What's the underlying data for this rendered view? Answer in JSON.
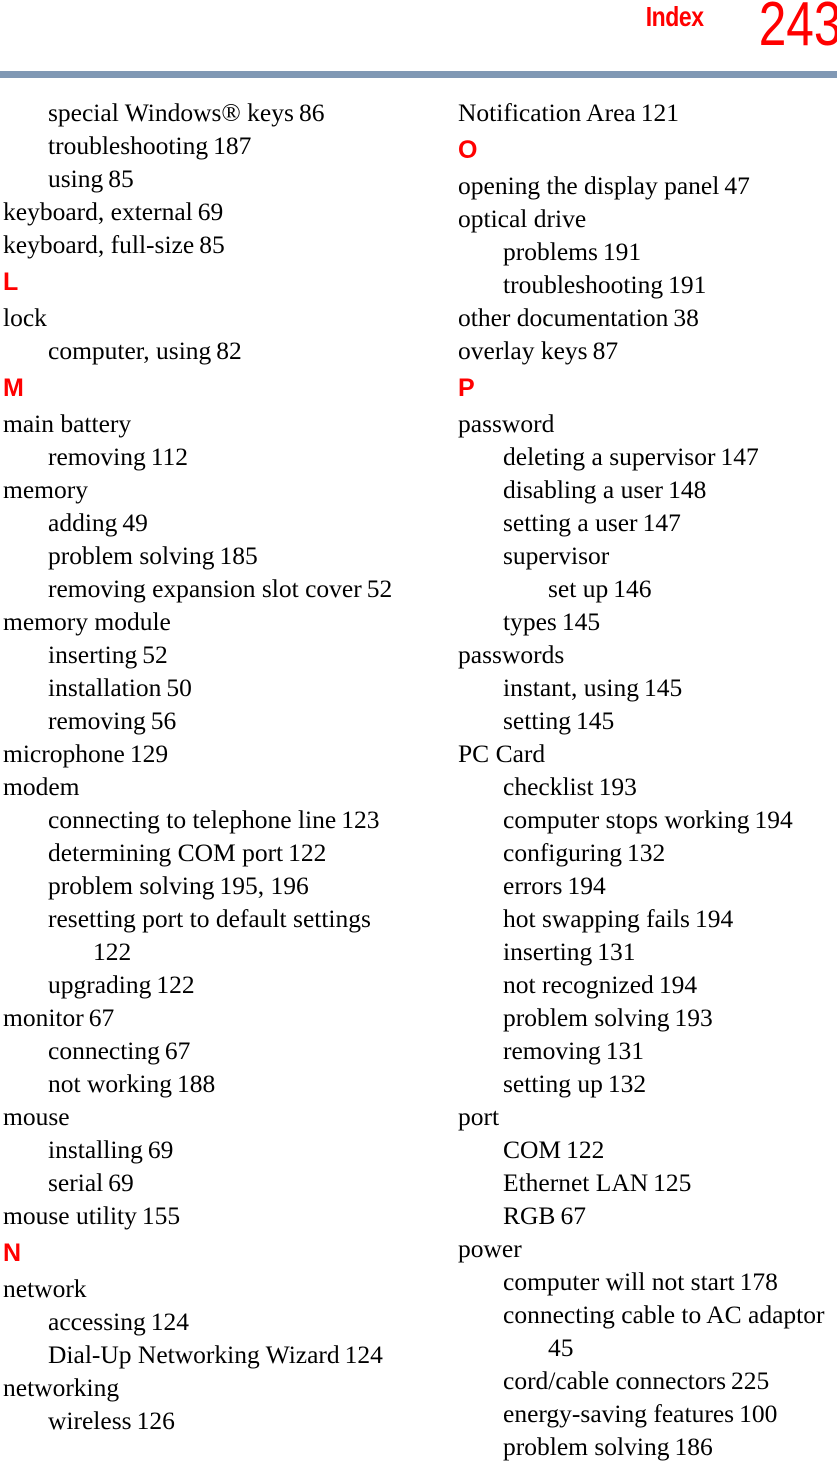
{
  "header": {
    "section_title": "Index",
    "page_number": "243",
    "accent_color": "#ff0000",
    "rule_color": "#8098b4"
  },
  "columns": [
    {
      "name": "left-column",
      "lines": [
        {
          "kind": "entry",
          "level": 1,
          "text": "special Windows® keys",
          "locator": "86"
        },
        {
          "kind": "entry",
          "level": 1,
          "text": "troubleshooting",
          "locator": "187"
        },
        {
          "kind": "entry",
          "level": 1,
          "text": "using",
          "locator": "85"
        },
        {
          "kind": "entry",
          "level": 0,
          "text": "keyboard, external",
          "locator": "69"
        },
        {
          "kind": "entry",
          "level": 0,
          "text": "keyboard, full-size",
          "locator": "85"
        },
        {
          "kind": "letter",
          "text": "L"
        },
        {
          "kind": "entry",
          "level": 0,
          "text": "lock",
          "locator": ""
        },
        {
          "kind": "entry",
          "level": 1,
          "text": "computer, using",
          "locator": "82"
        },
        {
          "kind": "letter",
          "text": "M"
        },
        {
          "kind": "entry",
          "level": 0,
          "text": "main battery",
          "locator": ""
        },
        {
          "kind": "entry",
          "level": 1,
          "text": "removing",
          "locator": "112"
        },
        {
          "kind": "entry",
          "level": 0,
          "text": "memory",
          "locator": ""
        },
        {
          "kind": "entry",
          "level": 1,
          "text": "adding",
          "locator": "49"
        },
        {
          "kind": "entry",
          "level": 1,
          "text": "problem solving",
          "locator": "185"
        },
        {
          "kind": "entry",
          "level": 1,
          "text": "removing expansion slot cover",
          "locator": "52"
        },
        {
          "kind": "entry",
          "level": 0,
          "text": "memory module",
          "locator": ""
        },
        {
          "kind": "entry",
          "level": 1,
          "text": "inserting",
          "locator": "52"
        },
        {
          "kind": "entry",
          "level": 1,
          "text": "installation",
          "locator": "50"
        },
        {
          "kind": "entry",
          "level": 1,
          "text": "removing",
          "locator": "56"
        },
        {
          "kind": "entry",
          "level": 0,
          "text": "microphone",
          "locator": "129"
        },
        {
          "kind": "entry",
          "level": 0,
          "text": "modem",
          "locator": ""
        },
        {
          "kind": "entry",
          "level": 1,
          "text": "connecting to telephone line",
          "locator": "123"
        },
        {
          "kind": "entry",
          "level": 1,
          "text": "determining COM port",
          "locator": "122"
        },
        {
          "kind": "entry",
          "level": 1,
          "text": "problem solving",
          "locator": "195, 196"
        },
        {
          "kind": "entry",
          "level": 1,
          "text": "resetting port to default settings",
          "locator": ""
        },
        {
          "kind": "entry",
          "level": 2,
          "text": "",
          "locator": "122"
        },
        {
          "kind": "entry",
          "level": 1,
          "text": "upgrading",
          "locator": "122"
        },
        {
          "kind": "entry",
          "level": 0,
          "text": "monitor",
          "locator": "67"
        },
        {
          "kind": "entry",
          "level": 1,
          "text": "connecting",
          "locator": "67"
        },
        {
          "kind": "entry",
          "level": 1,
          "text": "not working",
          "locator": "188"
        },
        {
          "kind": "entry",
          "level": 0,
          "text": "mouse",
          "locator": ""
        },
        {
          "kind": "entry",
          "level": 1,
          "text": "installing",
          "locator": "69"
        },
        {
          "kind": "entry",
          "level": 1,
          "text": "serial",
          "locator": "69"
        },
        {
          "kind": "entry",
          "level": 0,
          "text": "mouse utility",
          "locator": "155"
        },
        {
          "kind": "letter",
          "text": "N"
        },
        {
          "kind": "entry",
          "level": 0,
          "text": "network",
          "locator": ""
        },
        {
          "kind": "entry",
          "level": 1,
          "text": "accessing",
          "locator": "124"
        },
        {
          "kind": "entry",
          "level": 1,
          "text": "Dial-Up Networking Wizard",
          "locator": "124"
        },
        {
          "kind": "entry",
          "level": 0,
          "text": "networking",
          "locator": ""
        },
        {
          "kind": "entry",
          "level": 1,
          "text": "wireless",
          "locator": "126"
        }
      ]
    },
    {
      "name": "right-column",
      "lines": [
        {
          "kind": "entry",
          "level": 0,
          "text": "Notification Area",
          "locator": "121"
        },
        {
          "kind": "letter",
          "text": "O"
        },
        {
          "kind": "entry",
          "level": 0,
          "text": "opening the display panel",
          "locator": "47"
        },
        {
          "kind": "entry",
          "level": 0,
          "text": "optical drive",
          "locator": ""
        },
        {
          "kind": "entry",
          "level": 1,
          "text": "problems",
          "locator": "191"
        },
        {
          "kind": "entry",
          "level": 1,
          "text": "troubleshooting",
          "locator": "191"
        },
        {
          "kind": "entry",
          "level": 0,
          "text": "other documentation",
          "locator": "38"
        },
        {
          "kind": "entry",
          "level": 0,
          "text": "overlay keys",
          "locator": "87"
        },
        {
          "kind": "letter",
          "text": "P"
        },
        {
          "kind": "entry",
          "level": 0,
          "text": "password",
          "locator": ""
        },
        {
          "kind": "entry",
          "level": 1,
          "text": "deleting a supervisor",
          "locator": "147"
        },
        {
          "kind": "entry",
          "level": 1,
          "text": "disabling a user",
          "locator": "148"
        },
        {
          "kind": "entry",
          "level": 1,
          "text": "setting a user",
          "locator": "147"
        },
        {
          "kind": "entry",
          "level": 1,
          "text": "supervisor",
          "locator": ""
        },
        {
          "kind": "entry",
          "level": 2,
          "text": "set up",
          "locator": "146"
        },
        {
          "kind": "entry",
          "level": 1,
          "text": "types",
          "locator": "145"
        },
        {
          "kind": "entry",
          "level": 0,
          "text": "passwords",
          "locator": ""
        },
        {
          "kind": "entry",
          "level": 1,
          "text": "instant, using",
          "locator": "145"
        },
        {
          "kind": "entry",
          "level": 1,
          "text": "setting",
          "locator": "145"
        },
        {
          "kind": "entry",
          "level": 0,
          "text": "PC Card",
          "locator": ""
        },
        {
          "kind": "entry",
          "level": 1,
          "text": "checklist",
          "locator": "193"
        },
        {
          "kind": "entry",
          "level": 1,
          "text": "computer stops working",
          "locator": "194"
        },
        {
          "kind": "entry",
          "level": 1,
          "text": "configuring",
          "locator": "132"
        },
        {
          "kind": "entry",
          "level": 1,
          "text": "errors",
          "locator": "194"
        },
        {
          "kind": "entry",
          "level": 1,
          "text": "hot swapping fails",
          "locator": "194"
        },
        {
          "kind": "entry",
          "level": 1,
          "text": "inserting",
          "locator": "131"
        },
        {
          "kind": "entry",
          "level": 1,
          "text": "not recognized",
          "locator": "194"
        },
        {
          "kind": "entry",
          "level": 1,
          "text": "problem solving",
          "locator": "193"
        },
        {
          "kind": "entry",
          "level": 1,
          "text": "removing",
          "locator": "131"
        },
        {
          "kind": "entry",
          "level": 1,
          "text": "setting up",
          "locator": "132"
        },
        {
          "kind": "entry",
          "level": 0,
          "text": "port",
          "locator": ""
        },
        {
          "kind": "entry",
          "level": 1,
          "text": "COM",
          "locator": "122"
        },
        {
          "kind": "entry",
          "level": 1,
          "text": "Ethernet LAN",
          "locator": "125"
        },
        {
          "kind": "entry",
          "level": 1,
          "text": "RGB",
          "locator": "67"
        },
        {
          "kind": "entry",
          "level": 0,
          "text": "power",
          "locator": ""
        },
        {
          "kind": "entry",
          "level": 1,
          "text": "computer will not start",
          "locator": "178"
        },
        {
          "kind": "entry",
          "level": 1,
          "text": "connecting cable to AC adaptor",
          "locator": ""
        },
        {
          "kind": "entry",
          "level": 2,
          "text": "",
          "locator": "45"
        },
        {
          "kind": "entry",
          "level": 1,
          "text": "cord/cable connectors",
          "locator": "225"
        },
        {
          "kind": "entry",
          "level": 1,
          "text": "energy-saving features",
          "locator": "100"
        },
        {
          "kind": "entry",
          "level": 1,
          "text": "problem solving",
          "locator": "186"
        }
      ]
    }
  ]
}
